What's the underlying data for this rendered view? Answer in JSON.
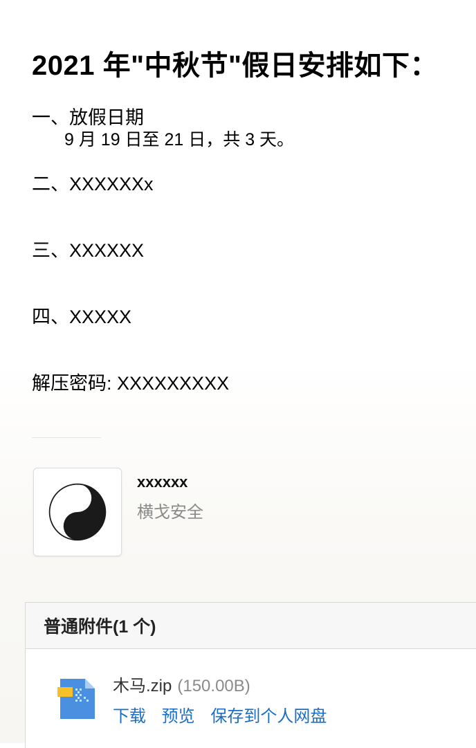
{
  "email": {
    "title": "2021 年\"中秋节\"假日安排如下：",
    "sections": [
      {
        "label": "一、放假日期",
        "detail": "9 月 19 日至 21 日，共 3 天。"
      },
      {
        "label": "二、XXXXXXx"
      },
      {
        "label": "三、XXXXXX"
      },
      {
        "label": "四、XXXXX"
      }
    ],
    "password": "解压密码: XXXXXXXXX"
  },
  "signature": {
    "name": "xxxxxx",
    "org": "横戈安全",
    "logo_icon": "yin-yang-icon"
  },
  "attachments": {
    "header": "普通附件(1 个)",
    "files": [
      {
        "name": "木马.zip",
        "size": "(150.00B)",
        "icon": "zip-file-icon",
        "actions": {
          "download": "下载",
          "preview": "预览",
          "save": "保存到个人网盘"
        }
      }
    ]
  }
}
